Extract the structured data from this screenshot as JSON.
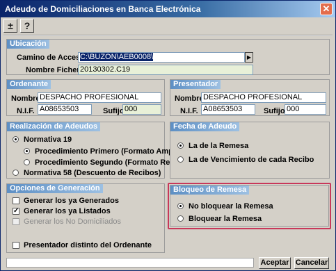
{
  "window": {
    "title": "Adeudo de Domiciliaciones en Banca Electrónica",
    "close_icon": "close-icon"
  },
  "toolbar": {
    "plusminus": "±",
    "help": "?"
  },
  "ubicacion": {
    "header": "Ubicación",
    "camino_label": "Camino de Acceso",
    "camino_value": "C:\\BUZON\\AEB0008\\",
    "nombre_fichero_label": "Nombre Fichero",
    "nombre_fichero_value": "20130302.C19"
  },
  "ordenante": {
    "header": "Ordenante",
    "nombre_label": "Nombre",
    "nombre_value": "DESPACHO PROFESIONAL",
    "nif_label": "N.I.F.",
    "nif_value": "A08653503",
    "sufijo_label": "Sufijo",
    "sufijo_value": "000"
  },
  "presentador": {
    "header": "Presentador",
    "nombre_label": "Nombre",
    "nombre_value": "DESPACHO PROFESIONAL",
    "nif_label": "N.I.F.",
    "nif_value": "A08653503",
    "sufijo_label": "Sufijo",
    "sufijo_value": "000"
  },
  "realizacion": {
    "header": "Realización de Adeudos",
    "normativa19": "Normativa 19",
    "proc_primero": "Procedimiento Primero (Formato Amp.)",
    "proc_segundo": "Procedimiento Segundo (Formato Red.)",
    "normativa58": "Normativa 58 (Descuento de Recibos)"
  },
  "fecha": {
    "header": "Fecha de Adeudo",
    "remesa": "La de la Remesa",
    "vencimiento": "La de Vencimiento de cada Recibo"
  },
  "opciones": {
    "header": "Opciones de Generación",
    "generar_generados": "Generar los ya Generados",
    "generar_listados": "Generar los ya Listados",
    "generar_no_domiciliados": "Generar los No Domiciliados",
    "presentador_distinto": "Presentador distinto del Ordenante"
  },
  "bloqueo": {
    "header": "Bloqueo de Remesa",
    "no_bloquear": "No bloquear la Remesa",
    "bloquear": "Bloquear la Remesa"
  },
  "buttons": {
    "aceptar": "Aceptar",
    "cancelar": "Cancelar"
  },
  "colors": {
    "highlight": "#c8385a",
    "title_bar": "#0a246a",
    "panel_header": "#5d8fc4"
  }
}
